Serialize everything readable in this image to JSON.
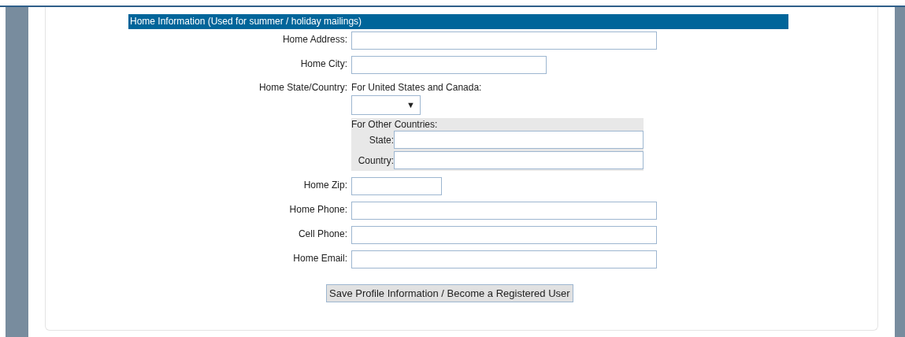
{
  "section_title": "Home Information (Used for summer / holiday mailings)",
  "fields": [
    {
      "kind": "wide",
      "label": "Home Address:"
    },
    {
      "kind": "medium",
      "label": "Home City:"
    },
    {
      "kind": "state_country",
      "label": "Home State/Country:",
      "us_caption": "For United States and Canada:",
      "dropdown_arrow": "▼",
      "other_caption": "For Other Countries:",
      "state_label": "State:",
      "country_label": "Country:"
    },
    {
      "kind": "narrow",
      "label": "Home Zip:"
    },
    {
      "kind": "wide",
      "label": "Home Phone:"
    },
    {
      "kind": "wide",
      "label": "Cell Phone:"
    },
    {
      "kind": "wide",
      "label": "Home Email:"
    }
  ],
  "submit_button": "Save Profile Information / Become a Registered User"
}
